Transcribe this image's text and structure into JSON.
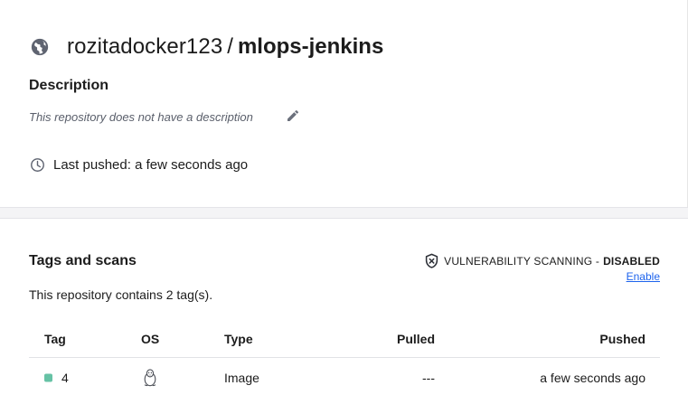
{
  "repo": {
    "namespace": "rozitadocker123",
    "separator": "/",
    "name": "mlops-jenkins",
    "visibility_icon": "globe-icon"
  },
  "description": {
    "heading": "Description",
    "text": "This repository does not have a description",
    "edit_icon": "pencil-icon"
  },
  "last_pushed": {
    "icon": "clock-icon",
    "text": "Last pushed: a few seconds ago"
  },
  "tags_section": {
    "heading": "Tags and scans",
    "count_text": "This repository contains 2 tag(s).",
    "scanning": {
      "icon": "shield-icon",
      "label": "VULNERABILITY SCANNING -",
      "value": "DISABLED",
      "enable_link": "Enable"
    },
    "columns": [
      "Tag",
      "OS",
      "Type",
      "Pulled",
      "Pushed"
    ],
    "rows": [
      {
        "tag": "4",
        "status_color": "#66c2a5",
        "os_icon": "linux-tux-icon",
        "type": "Image",
        "pulled": "---",
        "pushed": "a few seconds ago"
      }
    ]
  },
  "colors": {
    "link": "#1d63ed",
    "text": "#1c1c1c",
    "muted": "#5a5f6b",
    "band": "#f4f4f6"
  }
}
